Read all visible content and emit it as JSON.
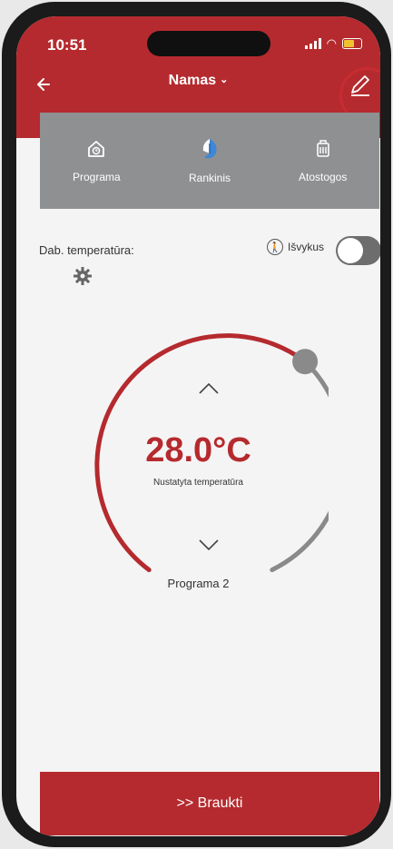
{
  "status_bar": {
    "time": "10:51"
  },
  "header": {
    "title": "Namas"
  },
  "modes": [
    {
      "label": "Programa",
      "icon": "clock-house-icon"
    },
    {
      "label": "Rankinis",
      "icon": "hand-icon"
    },
    {
      "label": "Atostogos",
      "icon": "luggage-icon"
    }
  ],
  "current_temperature": {
    "label": "Dab. temperatūra:"
  },
  "trip": {
    "label": "Išvykus",
    "enabled": false
  },
  "thermostat": {
    "value": "28.0°C",
    "caption": "Nustatyta temperatūra",
    "program": "Programa 2",
    "accent_color": "#b52a2e",
    "track_color": "#8a8a8a"
  },
  "footer": {
    "button_label": ">> Braukti"
  },
  "colors": {
    "brand": "#b52a2e",
    "panel": "#8f9092"
  }
}
